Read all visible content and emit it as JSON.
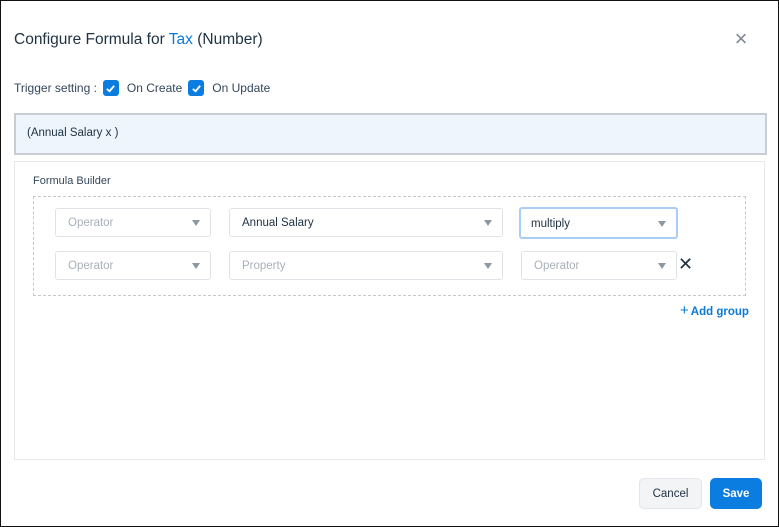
{
  "dialog": {
    "title_prefix": "Configure Formula for",
    "title_field": "Tax",
    "title_suffix": "(Number)",
    "close_icon": "close-icon"
  },
  "trigger": {
    "label": "Trigger setting :",
    "options": [
      {
        "label": "On Create",
        "checked": true
      },
      {
        "label": "On Update",
        "checked": true
      }
    ]
  },
  "formula_preview": "(Annual Salary x )",
  "builder": {
    "label": "Formula Builder",
    "rows": [
      {
        "operator": {
          "value": "",
          "placeholder": "Operator"
        },
        "property": {
          "value": "Annual Salary",
          "placeholder": "Property"
        },
        "operation": {
          "value": "multiply",
          "placeholder": "Operator"
        }
      },
      {
        "operator": {
          "value": "",
          "placeholder": "Operator"
        },
        "property": {
          "value": "",
          "placeholder": "Property"
        },
        "operation": {
          "value": "",
          "placeholder": "Operator"
        }
      }
    ],
    "add_group_label": "Add group"
  },
  "footer": {
    "cancel_label": "Cancel",
    "save_label": "Save"
  }
}
